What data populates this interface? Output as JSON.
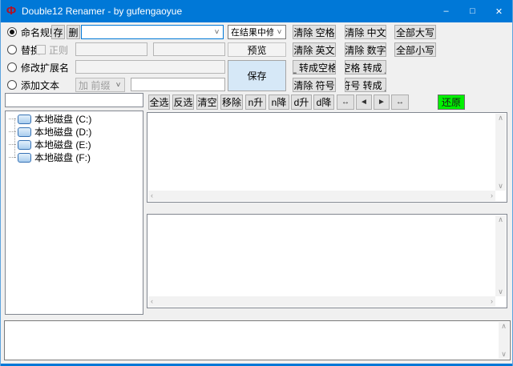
{
  "window": {
    "title": "Double12 Renamer - by gufengaoyue",
    "icon_glyph": "Φ"
  },
  "icons": {
    "minimize": "–",
    "maximize": "□",
    "close": "✕",
    "dropdown": "˅",
    "scroll_up": "∧",
    "scroll_down": "∨",
    "scroll_left": "‹",
    "scroll_right": "›",
    "arrow_left": "◄",
    "arrow_right": "►",
    "move_ends": "↔"
  },
  "colors": {
    "titlebar": "#0078d7",
    "restore_green": "#00f000",
    "save_highlight": "#d6e8f7"
  },
  "modes": {
    "rename_rule": {
      "label": "命名规则",
      "store_button": "存",
      "delete_button": "删",
      "pattern_value": ""
    },
    "replace": {
      "label": "替换",
      "regex_label": "正则",
      "find_value": "",
      "with_value": ""
    },
    "change_ext": {
      "label": "修改扩展名",
      "value": ""
    },
    "add_text": {
      "label": "添加文本",
      "position_value": "加 前缀",
      "text_value": ""
    }
  },
  "result_mode": {
    "selected": "在结果中修改"
  },
  "actions": {
    "preview": "预览",
    "save": "保存",
    "quick": [
      "清除 空格",
      "清除 中文",
      "全部大写",
      "清除 英文",
      "清除 数字",
      "全部小写",
      "_ 转成空格",
      "空格 转成 _",
      "清除 符号",
      "符号 转成 _"
    ]
  },
  "toolbar": {
    "buttons": [
      "全选",
      "反选",
      "清空",
      "移除",
      "n升",
      "n降",
      "d升",
      "d降"
    ],
    "restore": "还原"
  },
  "sidebar": {
    "path_value": "",
    "drives": [
      "本地磁盘 (C:)",
      "本地磁盘 (D:)",
      "本地磁盘 (E:)",
      "本地磁盘 (F:)"
    ]
  }
}
